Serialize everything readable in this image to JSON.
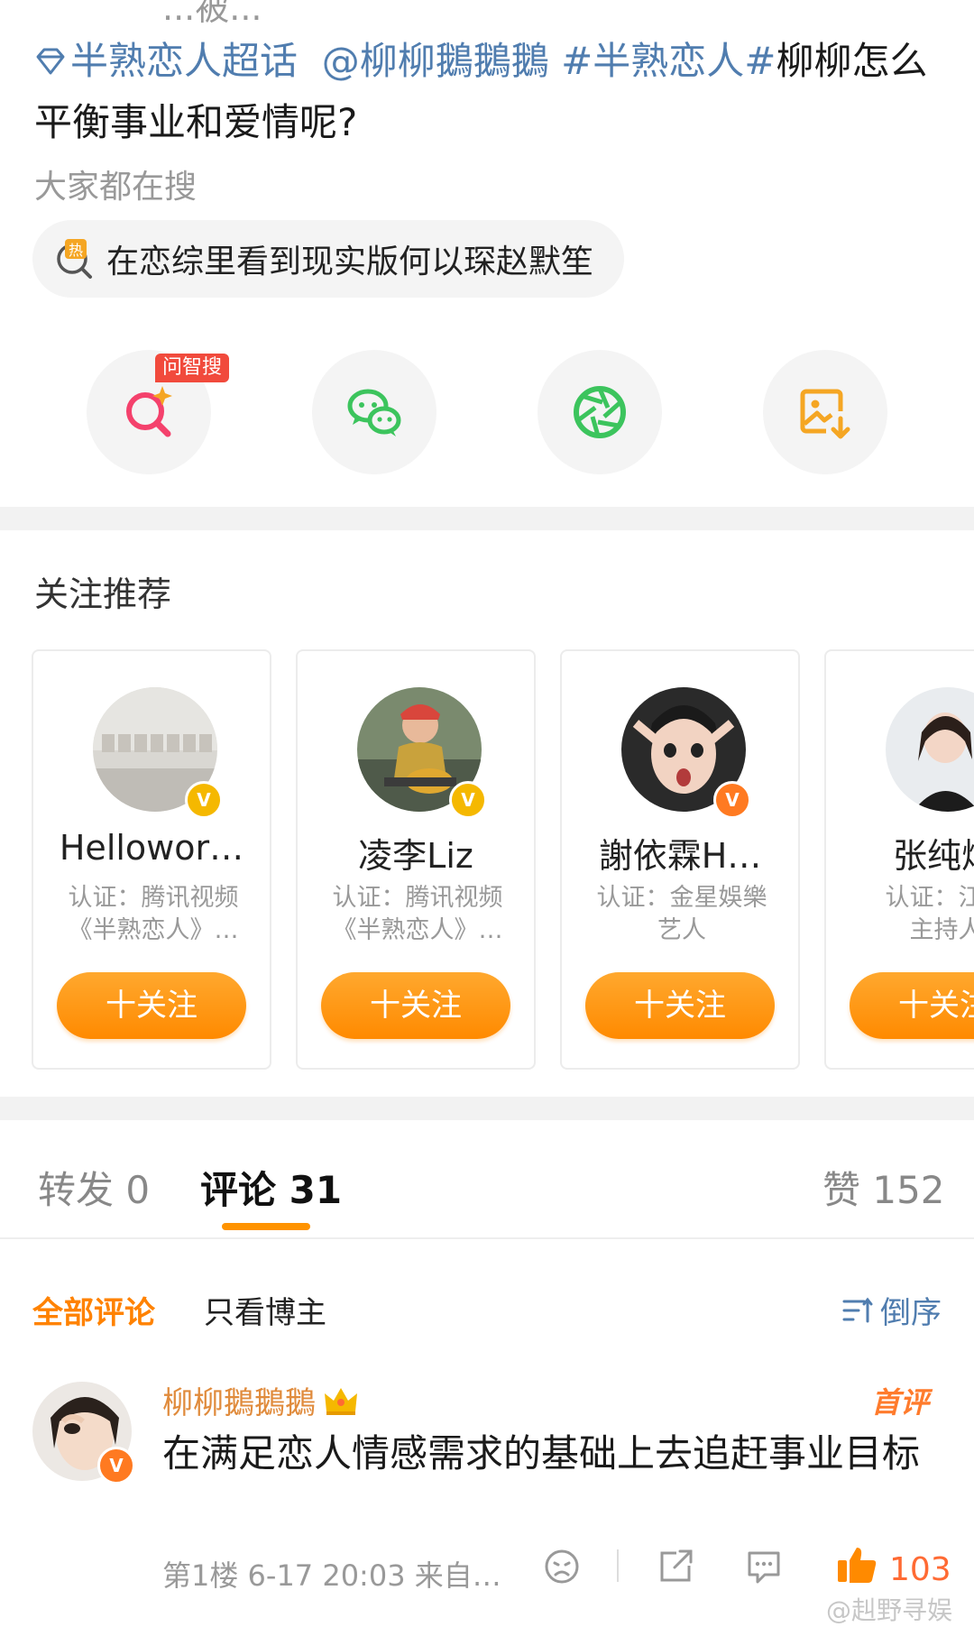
{
  "post": {
    "top_cutoff": "...被...",
    "supertopic": "半熟恋人超话",
    "mention": "@柳柳鵝鵝鵝",
    "hashtag": "#半熟恋人#",
    "text_after": "柳柳怎么",
    "text_line2": "平衡事业和爱情呢?"
  },
  "search": {
    "label": "大家都在搜",
    "hot_icon_badge": "热",
    "hot_query": "在恋综里看到现实版何以琛赵默笙"
  },
  "share": {
    "ai_tag": "问智搜",
    "items": [
      {
        "icon": "ai-search-icon",
        "color": "#f4416c"
      },
      {
        "icon": "wechat-icon",
        "color": "#3cc45d"
      },
      {
        "icon": "moments-icon",
        "color": "#3cc45d"
      },
      {
        "icon": "save-image-icon",
        "color": "#f5a623"
      }
    ]
  },
  "recommend": {
    "title": "关注推荐",
    "follow_label": "十关注",
    "cards": [
      {
        "name": "Hellowor…",
        "cert_line1": "认证：腾讯视频",
        "cert_line2": "《半熟恋人》…",
        "badge_color": "#f5b800"
      },
      {
        "name": "凌李Liz",
        "cert_line1": "认证：腾讯视频",
        "cert_line2": "《半熟恋人》…",
        "badge_color": "#f5b800"
      },
      {
        "name": "謝依霖H…",
        "cert_line1": "认证：金星娛樂",
        "cert_line2": "艺人",
        "badge_color": "#ff7a21"
      },
      {
        "name": "张纯烨",
        "cert_line1": "认证：江苏",
        "cert_line2": "主持人",
        "badge_color": "#f5b800"
      }
    ]
  },
  "tabs": {
    "repost": "转发 0",
    "comment": "评论 31",
    "like": "赞 152"
  },
  "filters": {
    "all": "全部评论",
    "owner_only": "只看博主",
    "sort": "倒序"
  },
  "comment": {
    "author": "柳柳鵝鵝鵝",
    "first_badge": "首评",
    "text": "在满足恋人情感需求的基础上去追赶事业目标",
    "meta": "第1楼 6-17 20:03 来自…",
    "likes": "103"
  },
  "watermark": "@赳野寻娱",
  "colors": {
    "accent_orange": "#ff8a00",
    "link_blue": "#507daf"
  }
}
